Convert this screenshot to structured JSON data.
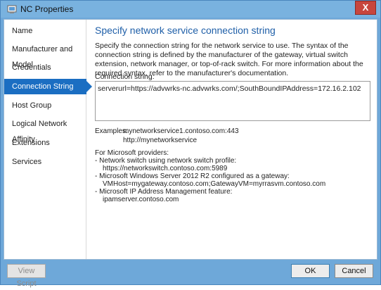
{
  "window": {
    "title": "NC Properties",
    "close_glyph": "X"
  },
  "nav": {
    "items": [
      {
        "label": "Name"
      },
      {
        "label": "Manufacturer and Model"
      },
      {
        "label": "Credentials"
      },
      {
        "label": "Connection String"
      },
      {
        "label": "Host Group"
      },
      {
        "label": "Logical Network Affinity"
      },
      {
        "label": "Extensions"
      },
      {
        "label": "Services"
      }
    ],
    "active": "Connection String"
  },
  "main": {
    "heading": "Specify network service connection string",
    "description": "Specify the connection string for the network service to use. The syntax of the connection string is defined by the manufacturer of the gateway, virtual switch extension, network manager, or top-of-rack switch. For more information about the required syntax, refer to the manufacturer's documentation.",
    "connection_label": "Connection string:",
    "connection_value": "serverurl=https://advwrks-nc.advwrks.com/;SouthBoundIPAddress=172.16.2.102",
    "examples_label": "Examples:",
    "example_1": "mynetworkservice1.contoso.com:443",
    "example_2": "http://mynetworkservice",
    "ms_header": "For Microsoft providers:",
    "ms_1": "- Network switch using network switch profile:",
    "ms_1_value": "https://networkswitch.contoso.com:5989",
    "ms_2": "- Microsoft Windows Server 2012 R2 configured as a gateway:",
    "ms_2_value": "VMHost=mygateway.contoso.com;GatewayVM=myrrasvm.contoso.com",
    "ms_3": "- Microsoft IP Address Management feature:",
    "ms_3_value": "ipamserver.contoso.com"
  },
  "footer": {
    "view_script": "View Script",
    "ok": "OK",
    "cancel": "Cancel"
  },
  "colors": {
    "accent": "#1b6ec2",
    "heading": "#1f5fa8",
    "frame": "#6ea8d9",
    "close": "#c7463d"
  }
}
